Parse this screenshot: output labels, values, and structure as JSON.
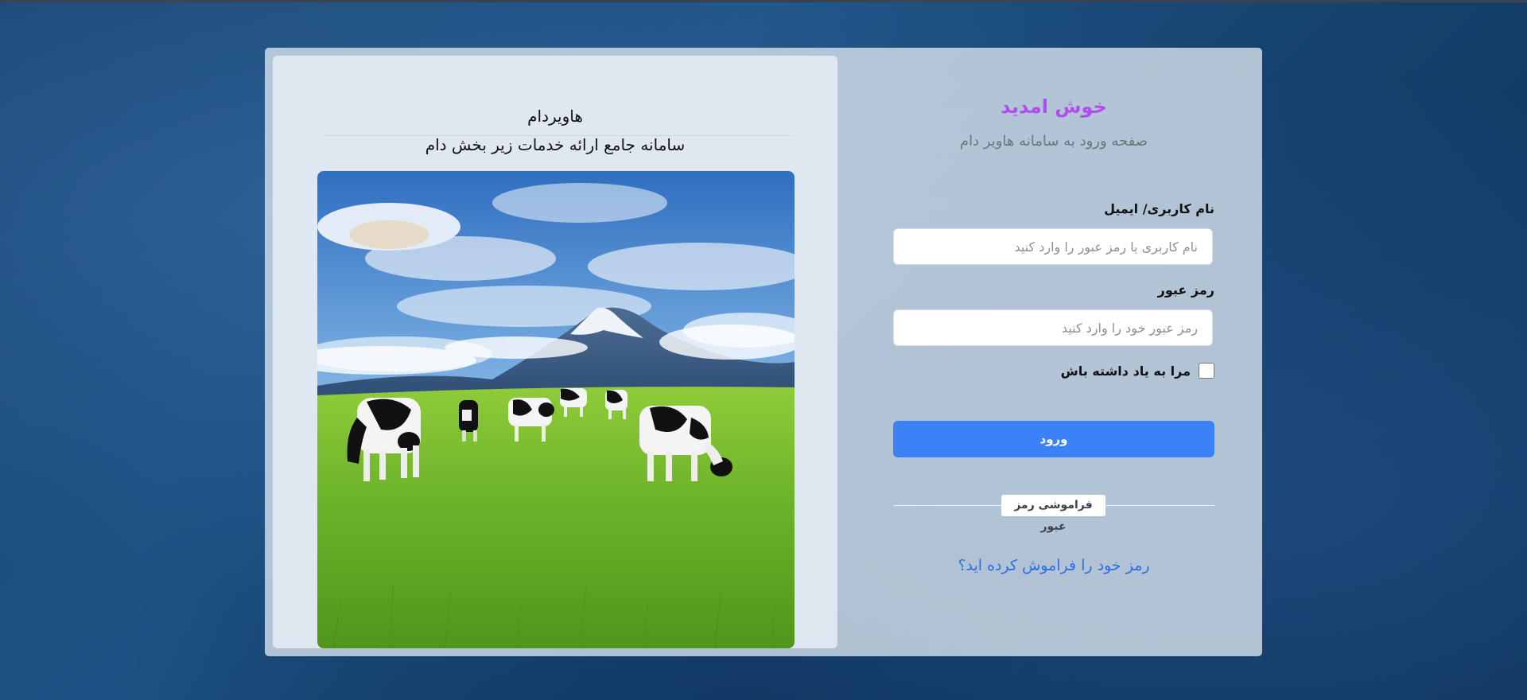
{
  "info": {
    "brand_name": "هاویردام",
    "tagline": "سامانه جامع ارائه خدمات زیر بخش دام",
    "hero_image": "cows-grazing-meadow-mountain-image"
  },
  "login": {
    "welcome": "خوش امدید",
    "subtitle": "صفحه ورود به سامانه هاویر دام",
    "username_label": "نام کاربری/ ایمیل",
    "username_placeholder": "نام کاربری یا رمز عبور را وارد کنید",
    "username_value": "",
    "password_label": "رمز عبور",
    "password_placeholder": "رمز عبور خود را وارد کنید",
    "password_value": "",
    "remember_label": "مرا به یاد داشته باش",
    "remember_checked": false,
    "submit_label": "ورود",
    "separator_label": "فراموشی رمز عبور",
    "forgot_link": "رمز خود را فراموش کرده اید؟"
  },
  "colors": {
    "accent": "#3b82f6",
    "welcome": "#b14df0",
    "link": "#2b6fe6",
    "background": "#1d5384"
  }
}
